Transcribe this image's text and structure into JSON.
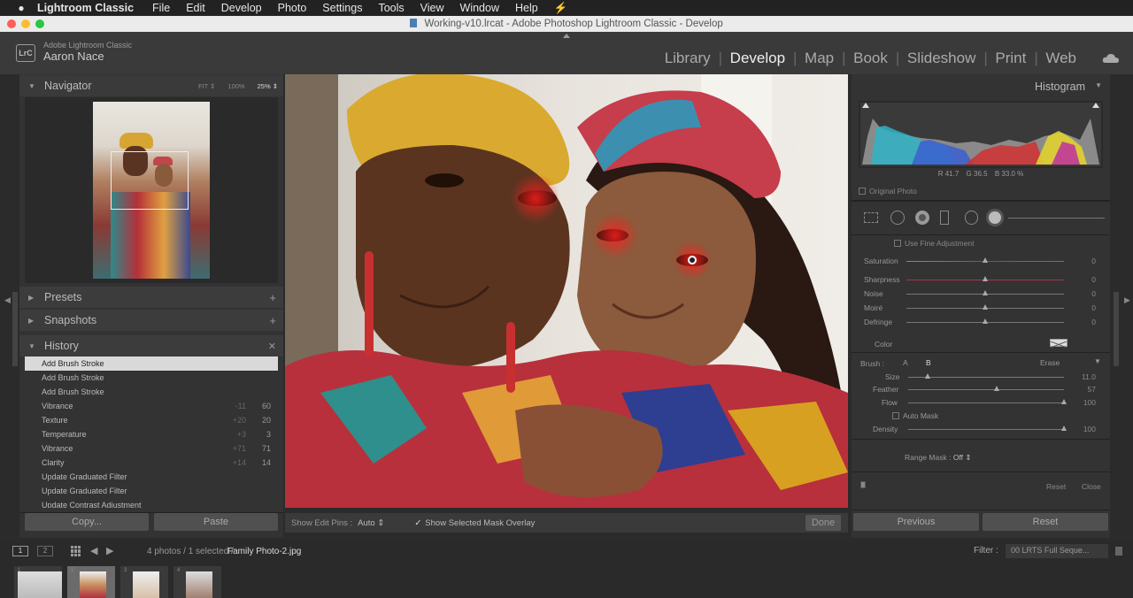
{
  "menubar": {
    "apple_icon": "apple-icon",
    "app_name": "Lightroom Classic",
    "items": [
      "File",
      "Edit",
      "Develop",
      "Photo",
      "Settings",
      "Tools",
      "View",
      "Window",
      "Help"
    ]
  },
  "window": {
    "title": "Working-v10.lrcat - Adobe Photoshop Lightroom Classic - Develop"
  },
  "identity": {
    "logo_text": "LrC",
    "product": "Adobe Lightroom Classic",
    "user": "Aaron Nace"
  },
  "modules": {
    "items": [
      "Library",
      "Develop",
      "Map",
      "Book",
      "Slideshow",
      "Print",
      "Web"
    ],
    "active": "Develop",
    "cloud_icon": "cloud-icon"
  },
  "left_panel": {
    "navigator": {
      "title": "Navigator",
      "zoom_options": [
        "FIT ⇕",
        "100%",
        "25% ⇕"
      ]
    },
    "presets": {
      "title": "Presets"
    },
    "snapshots": {
      "title": "Snapshots"
    },
    "history": {
      "title": "History",
      "items": [
        {
          "label": "Add Brush Stroke",
          "delta": "",
          "value": ""
        },
        {
          "label": "Add Brush Stroke",
          "delta": "",
          "value": ""
        },
        {
          "label": "Add Brush Stroke",
          "delta": "",
          "value": ""
        },
        {
          "label": "Vibrance",
          "delta": "-11",
          "value": "60"
        },
        {
          "label": "Texture",
          "delta": "+20",
          "value": "20"
        },
        {
          "label": "Temperature",
          "delta": "+3",
          "value": "3"
        },
        {
          "label": "Vibrance",
          "delta": "+71",
          "value": "71"
        },
        {
          "label": "Clarity",
          "delta": "+14",
          "value": "14"
        },
        {
          "label": "Update Graduated Filter",
          "delta": "",
          "value": ""
        },
        {
          "label": "Update Graduated Filter",
          "delta": "",
          "value": ""
        },
        {
          "label": "Update Contrast Adjustment",
          "delta": "",
          "value": ""
        }
      ]
    },
    "copy_label": "Copy...",
    "paste_label": "Paste"
  },
  "toolbar": {
    "show_edit_pins_label": "Show Edit Pins :",
    "show_edit_pins_value": "Auto ⇕",
    "show_mask_overlay_label": "Show Selected Mask Overlay",
    "show_mask_overlay_checked": true,
    "done_label": "Done"
  },
  "right_panel": {
    "histogram": {
      "title": "Histogram",
      "r_label": "R",
      "r_value": "41.7",
      "g_label": "G",
      "g_value": "36.5",
      "b_label": "B",
      "b_value": "33.0 %",
      "original_photo_label": "Original Photo"
    },
    "fine_adjustment_label": "Use Fine Adjustment",
    "sliders": [
      {
        "label": "Saturation",
        "value": "0",
        "position": 0.5
      },
      {
        "label": "Sharpness",
        "value": "0",
        "position": 0.5
      },
      {
        "label": "Noise",
        "value": "0",
        "position": 0.5
      },
      {
        "label": "Moiré",
        "value": "0",
        "position": 0.5
      },
      {
        "label": "Defringe",
        "value": "0",
        "position": 0.5
      }
    ],
    "color_label": "Color",
    "brush": {
      "label": "Brush :",
      "a_label": "A",
      "b_label": "B",
      "erase_label": "Erase",
      "size_label": "Size",
      "size_value": "11.0",
      "size_position": 0.13,
      "feather_label": "Feather",
      "feather_value": "57",
      "feather_position": 0.57,
      "flow_label": "Flow",
      "flow_value": "100",
      "flow_position": 1.0,
      "auto_mask_label": "Auto Mask",
      "density_label": "Density",
      "density_value": "100",
      "density_position": 1.0
    },
    "range_mask_label": "Range Mask :",
    "range_mask_value": "Off ⇕",
    "reset_label": "Reset",
    "close_label": "Close",
    "previous_label": "Previous",
    "reset_all_label": "Reset"
  },
  "filmstrip": {
    "screen1": "1",
    "screen2": "2",
    "info": "4 photos / 1 selected /",
    "filename": "Family Photo-2.jpg",
    "filter_label": "Filter :",
    "filter_value": "00 LRTS Full Seque...",
    "thumb_numbers": [
      "1",
      "2",
      "3",
      "4"
    ],
    "selected_index": 1
  }
}
